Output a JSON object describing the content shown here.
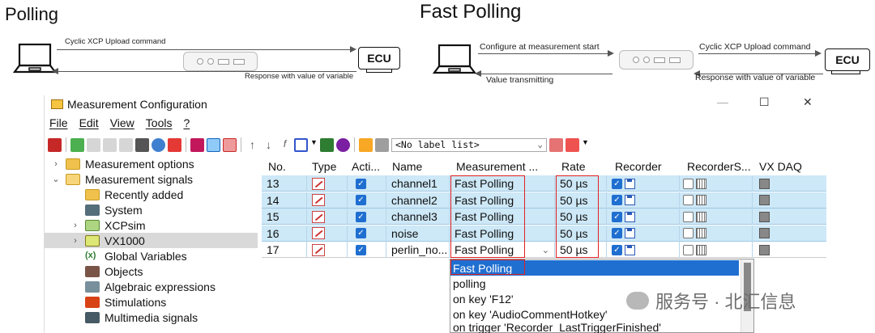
{
  "diagram_polling": {
    "title": "Polling",
    "msg_top": "Cyclic XCP Upload command",
    "msg_bottom": "Response with value of variable",
    "ecu": "ECU"
  },
  "diagram_fast": {
    "title": "Fast Polling",
    "msg_top_left": "Configure at measurement start",
    "msg_top_right": "Cyclic XCP Upload command",
    "msg_bottom_left": "Value transmitting",
    "msg_bottom_right": "Response with value of variable",
    "ecu": "ECU"
  },
  "window": {
    "title": "Measurement Configuration",
    "minimize": "—",
    "maximize": "☐",
    "close": "✕"
  },
  "menu": [
    "File",
    "Edit",
    "View",
    "Tools",
    "?"
  ],
  "toolbar": {
    "label_list": "<No label list>"
  },
  "tree": [
    {
      "label": "Measurement options",
      "twisty": "›",
      "icon": "folder"
    },
    {
      "label": "Measurement signals",
      "twisty": "⌄",
      "icon": "folder-open"
    },
    {
      "label": "Recently added",
      "twisty": "",
      "icon": "folder"
    },
    {
      "label": "System",
      "twisty": "",
      "icon": "system"
    },
    {
      "label": "XCPsim",
      "twisty": "›",
      "icon": "device"
    },
    {
      "label": "VX1000",
      "twisty": "›",
      "icon": "device"
    },
    {
      "label": "Global Variables",
      "twisty": "",
      "icon": "variables"
    },
    {
      "label": "Objects",
      "twisty": "",
      "icon": "objects"
    },
    {
      "label": "Algebraic expressions",
      "twisty": "",
      "icon": "algebra"
    },
    {
      "label": "Stimulations",
      "twisty": "",
      "icon": "stimulation"
    },
    {
      "label": "Multimedia signals",
      "twisty": "",
      "icon": "multimedia"
    }
  ],
  "grid": {
    "columns": [
      "No.",
      "Type",
      "Acti...",
      "Name",
      "Measurement ...",
      "Rate",
      "Recorder",
      "RecorderS...",
      "VX DAQ"
    ],
    "rows": [
      {
        "no": "13",
        "name": "channel1",
        "mode": "Fast Polling",
        "rate": "50 µs"
      },
      {
        "no": "14",
        "name": "channel2",
        "mode": "Fast Polling",
        "rate": "50 µs"
      },
      {
        "no": "15",
        "name": "channel3",
        "mode": "Fast Polling",
        "rate": "50 µs"
      },
      {
        "no": "16",
        "name": "noise",
        "mode": "Fast Polling",
        "rate": "50 µs"
      },
      {
        "no": "17",
        "name": "perlin_no...",
        "mode": "Fast Polling",
        "rate": "50 µs"
      }
    ]
  },
  "dropdown": {
    "options": [
      "Fast Polling",
      "polling",
      "on key 'F12'",
      "on key 'AudioCommentHotkey'",
      "on trigger 'Recorder_LastTriggerFinished'"
    ]
  },
  "watermark": "服务号 · 北汇信息"
}
